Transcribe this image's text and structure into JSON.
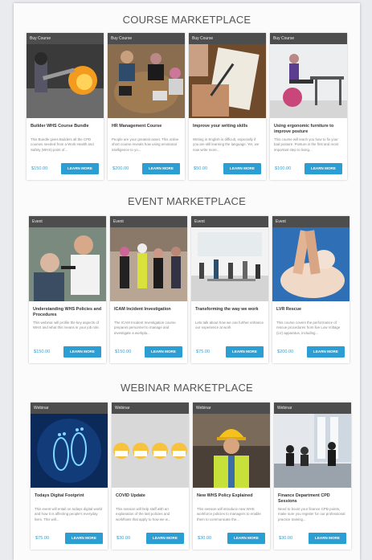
{
  "sections": [
    {
      "title": "COURSE MARKETPLACE",
      "cards": [
        {
          "tag": "Buy Course",
          "title": "Builder WHS Course Bundle",
          "desc": "This Bundle gives Builders all the CPD courses needed from a Work Health and Safety (WHS) point of...",
          "price": "$150.00",
          "button": "LEARN MORE"
        },
        {
          "tag": "Buy Course",
          "title": "HR Management Course",
          "desc": "People are your greatest asset. This online short course reveals how using emotional intelligence to yo...",
          "price": "$200.00",
          "button": "LEARN MORE"
        },
        {
          "tag": "Buy Course",
          "title": "Improve your writing skills",
          "desc": "Writing in English is difficult, especially if you are still learning the language. Yet, we now write more...",
          "price": "$50.00",
          "button": "LEARN MORE"
        },
        {
          "tag": "Buy Course",
          "title": "Using ergonomic furniture to improve posture",
          "desc": "This course will teach you how to fix your bad posture. Posture is the first and most important step to living...",
          "price": "$100.00",
          "button": "LEARN MORE"
        }
      ]
    },
    {
      "title": "EVENT MARKETPLACE",
      "cards": [
        {
          "tag": "Event",
          "title": "Understanding WHS Policies and Procedures",
          "desc": "This webinar will profile the key aspects of WHS and what this means in your job role.",
          "price": "$150.00",
          "button": "LEARN MORE"
        },
        {
          "tag": "Event",
          "title": "ICAM Incident Investigation",
          "desc": "The ICAM Incident Investigation course prepares personnel to manage and investigate a workpla...",
          "price": "$150.00",
          "button": "LEARN MORE"
        },
        {
          "tag": "Event",
          "title": "Transforming the way we work",
          "desc": "Lets talk about how we can further enhance our experience at work",
          "price": "$75.00",
          "button": "LEARN MORE"
        },
        {
          "tag": "Event",
          "title": "LVR Rescue",
          "desc": "This course covers the performance of rescue procedures from live Low Voltage (LV) apparatus, including...",
          "price": "$200.00",
          "button": "LEARN MORE"
        }
      ]
    },
    {
      "title": "WEBINAR MARKETPLACE",
      "cards": [
        {
          "tag": "Webinar",
          "title": "Todays Digital Footprint",
          "desc": "This event will entail on todays digital world and how it is affecting people's everyday lives. This will...",
          "price": "$75.00",
          "button": "LEARN MORE"
        },
        {
          "tag": "Webinar",
          "title": "COVID Update",
          "desc": "This session will help staff with an explanation of the last policies and workflows that apply to how we w...",
          "price": "$30.00",
          "button": "LEARN MORE"
        },
        {
          "tag": "Webinar",
          "title": "New WHS Policy Explained",
          "desc": "This session will introduce new WHS workforce policies to managers to enable them to communicate the...",
          "price": "$30.00",
          "button": "LEARN MORE"
        },
        {
          "tag": "Webinar",
          "title": "Finance Department CPD Sessions",
          "desc": "Need to boost your finance CPD points, make sure you register for our professional practice training...",
          "price": "$30.00",
          "button": "LEARN MORE"
        }
      ]
    }
  ],
  "theme": {
    "accent": "#2b9fd3",
    "tag_bg": "#4d4d4d",
    "title_color": "#555555"
  }
}
